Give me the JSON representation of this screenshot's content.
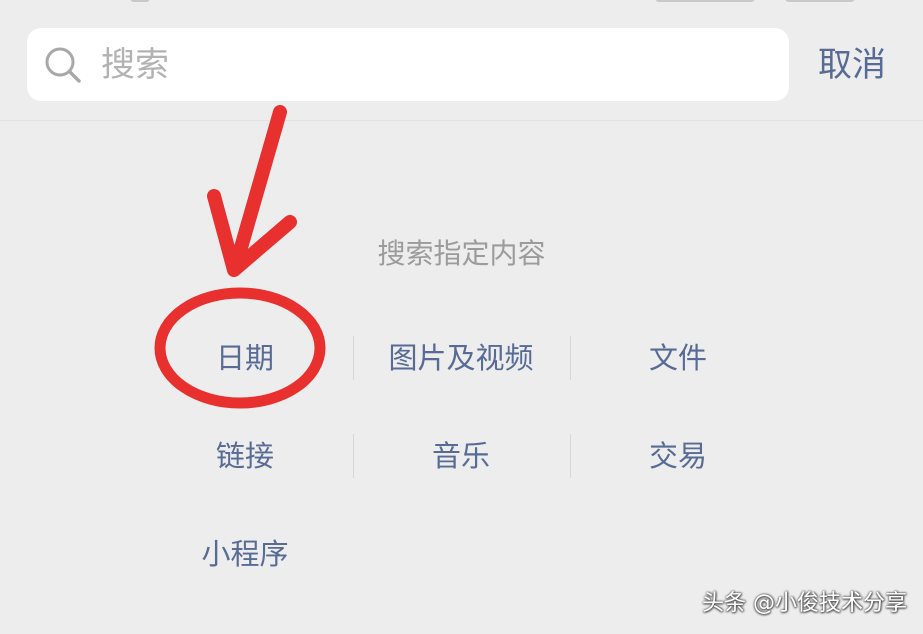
{
  "search": {
    "placeholder": "搜索",
    "value": ""
  },
  "cancel_label": "取消",
  "section_title": "搜索指定内容",
  "categories": [
    {
      "label": "日期",
      "highlighted": true
    },
    {
      "label": "图片及视频"
    },
    {
      "label": "文件"
    },
    {
      "label": "链接"
    },
    {
      "label": "音乐"
    },
    {
      "label": "交易"
    },
    {
      "label": "小程序"
    }
  ],
  "watermark": "头条 @小俊技术分享",
  "colors": {
    "background": "#ededed",
    "link": "#576b95",
    "muted": "#9b9b9b",
    "annotation": "#e8302f"
  }
}
